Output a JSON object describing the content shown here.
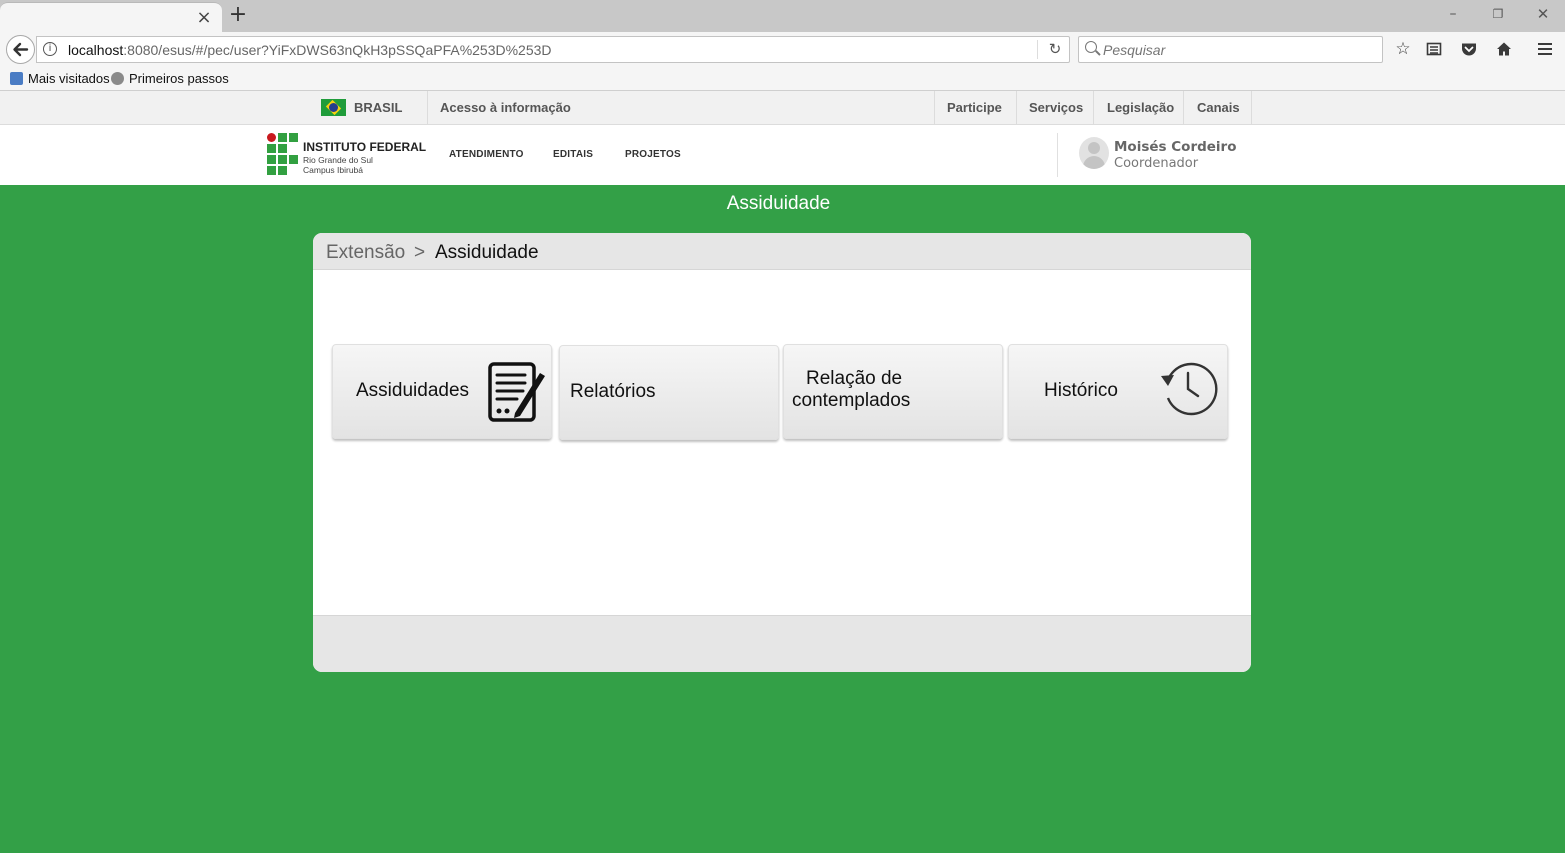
{
  "browser": {
    "url_host": "localhost",
    "url_rest": ":8080/esus/#/pec/user?YiFxDWS63nQkH3pSSQaPFA%253D%253D",
    "search_placeholder": "Pesquisar",
    "bookmarks": [
      "Mais visitados",
      "Primeiros passos"
    ]
  },
  "govbar": {
    "brasil": "BRASIL",
    "acesso": "Acesso à informação",
    "links": [
      "Participe",
      "Serviços",
      "Legislação",
      "Canais"
    ]
  },
  "header": {
    "logo_title": "INSTITUTO FEDERAL",
    "logo_line2": "Rio Grande do Sul",
    "logo_line3": "Campus Ibirubá",
    "menu": [
      "ATENDIMENTO",
      "EDITAIS",
      "PROJETOS"
    ],
    "user_name": "Moisés Cordeiro",
    "user_role": "Coordenador"
  },
  "main": {
    "page_title": "Assiduidade",
    "breadcrumb_parent": "Extensão",
    "breadcrumb_sep": ">",
    "breadcrumb_current": "Assiduidade",
    "tiles": [
      {
        "label": "Assiduidades",
        "icon": "document-edit-icon"
      },
      {
        "label": "Relatórios",
        "icon": ""
      },
      {
        "label_line1": "Relação de",
        "label_line2": "contemplados",
        "icon": ""
      },
      {
        "label": "Histórico",
        "icon": "history-clock-icon"
      }
    ]
  },
  "colors": {
    "page_bg": "#33a047",
    "panel_head": "#e6e6e6",
    "logo_green": "#32a041",
    "logo_red": "#c8191e"
  }
}
